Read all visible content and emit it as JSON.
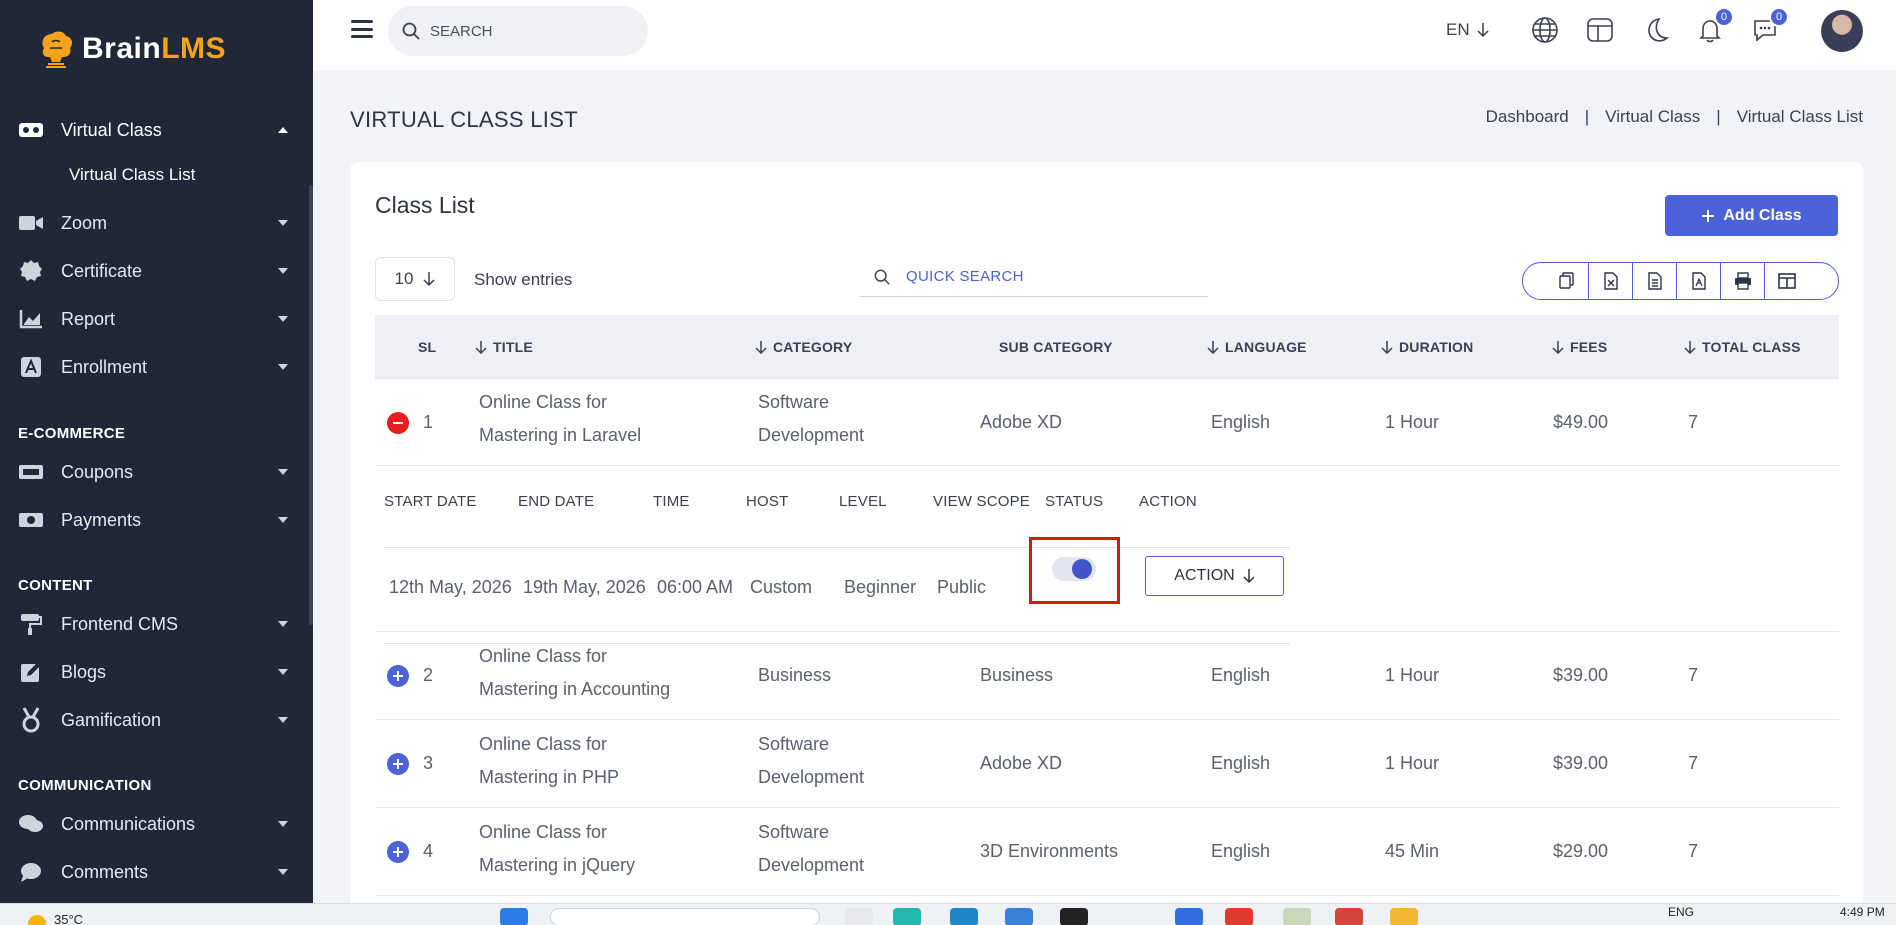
{
  "app": {
    "brand_main": "Brain",
    "brand_accent": "LMS",
    "accent_color": "#4b62d8"
  },
  "sidebar": {
    "items": [
      {
        "label": "Virtual Class",
        "icon": "vr-glasses-icon"
      },
      {
        "label": "Zoom",
        "icon": "video-camera-icon"
      },
      {
        "label": "Certificate",
        "icon": "certificate-badge-icon"
      },
      {
        "label": "Report",
        "icon": "chart-icon"
      },
      {
        "label": "Enrollment",
        "icon": "enrollment-icon"
      },
      {
        "label": "Coupons",
        "icon": "coupon-icon"
      },
      {
        "label": "Payments",
        "icon": "money-icon"
      },
      {
        "label": "Frontend CMS",
        "icon": "paint-roller-icon"
      },
      {
        "label": "Blogs",
        "icon": "edit-icon"
      },
      {
        "label": "Gamification",
        "icon": "medal-icon"
      },
      {
        "label": "Communications",
        "icon": "chat-icon"
      },
      {
        "label": "Comments",
        "icon": "comment-icon"
      }
    ],
    "submenu_active": "Virtual Class List",
    "sections": {
      "ecommerce": "E-COMMERCE",
      "content": "CONTENT",
      "communication": "COMMUNICATION"
    }
  },
  "topbar": {
    "search_placeholder": "SEARCH",
    "language": "EN",
    "notification_count": "0",
    "message_count": "0"
  },
  "page": {
    "title": "VIRTUAL CLASS LIST",
    "breadcrumb": [
      "Dashboard",
      "Virtual Class",
      "Virtual Class List"
    ],
    "separator": "|"
  },
  "card": {
    "title": "Class List",
    "add_button": "Add Class",
    "entries_value": "10",
    "entries_label": "Show entries",
    "quick_search_placeholder": "QUICK SEARCH"
  },
  "table": {
    "headers": [
      "SL",
      "TITLE",
      "CATEGORY",
      "SUB CATEGORY",
      "LANGUAGE",
      "DURATION",
      "FEES",
      "TOTAL CLASS"
    ],
    "rows": [
      {
        "sl": "1",
        "title1": "Online Class for",
        "title2": "Mastering in Laravel",
        "cat1": "Software",
        "cat2": "Development",
        "sub": "Adobe XD",
        "lang": "English",
        "dur": "1 Hour",
        "fees": "$49.00",
        "total": "7"
      },
      {
        "sl": "2",
        "title1": "Online Class for",
        "title2": "Mastering in Accounting",
        "cat1": "Business",
        "cat2": "",
        "sub": "Business",
        "lang": "English",
        "dur": "1 Hour",
        "fees": "$39.00",
        "total": "7"
      },
      {
        "sl": "3",
        "title1": "Online Class for",
        "title2": "Mastering in PHP",
        "cat1": "Software",
        "cat2": "Development",
        "sub": "Adobe XD",
        "lang": "English",
        "dur": "1 Hour",
        "fees": "$39.00",
        "total": "7"
      },
      {
        "sl": "4",
        "title1": "Online Class for",
        "title2": "Mastering in jQuery",
        "cat1": "Software",
        "cat2": "Development",
        "sub": "3D Environments",
        "lang": "English",
        "dur": "45 Min",
        "fees": "$29.00",
        "total": "7"
      }
    ],
    "child": {
      "headers": [
        "START DATE",
        "END DATE",
        "TIME",
        "HOST",
        "LEVEL",
        "VIEW SCOPE",
        "STATUS",
        "ACTION"
      ],
      "values": {
        "start": "12th May, 2026",
        "end": "19th May, 2026",
        "time": "06:00 AM",
        "host": "Custom",
        "level": "Beginner",
        "scope": "Public"
      },
      "status_on": true,
      "action_label": "ACTION"
    }
  },
  "taskbar": {
    "weather": "35°C",
    "lang": "ENG",
    "time": "4:49 PM"
  }
}
